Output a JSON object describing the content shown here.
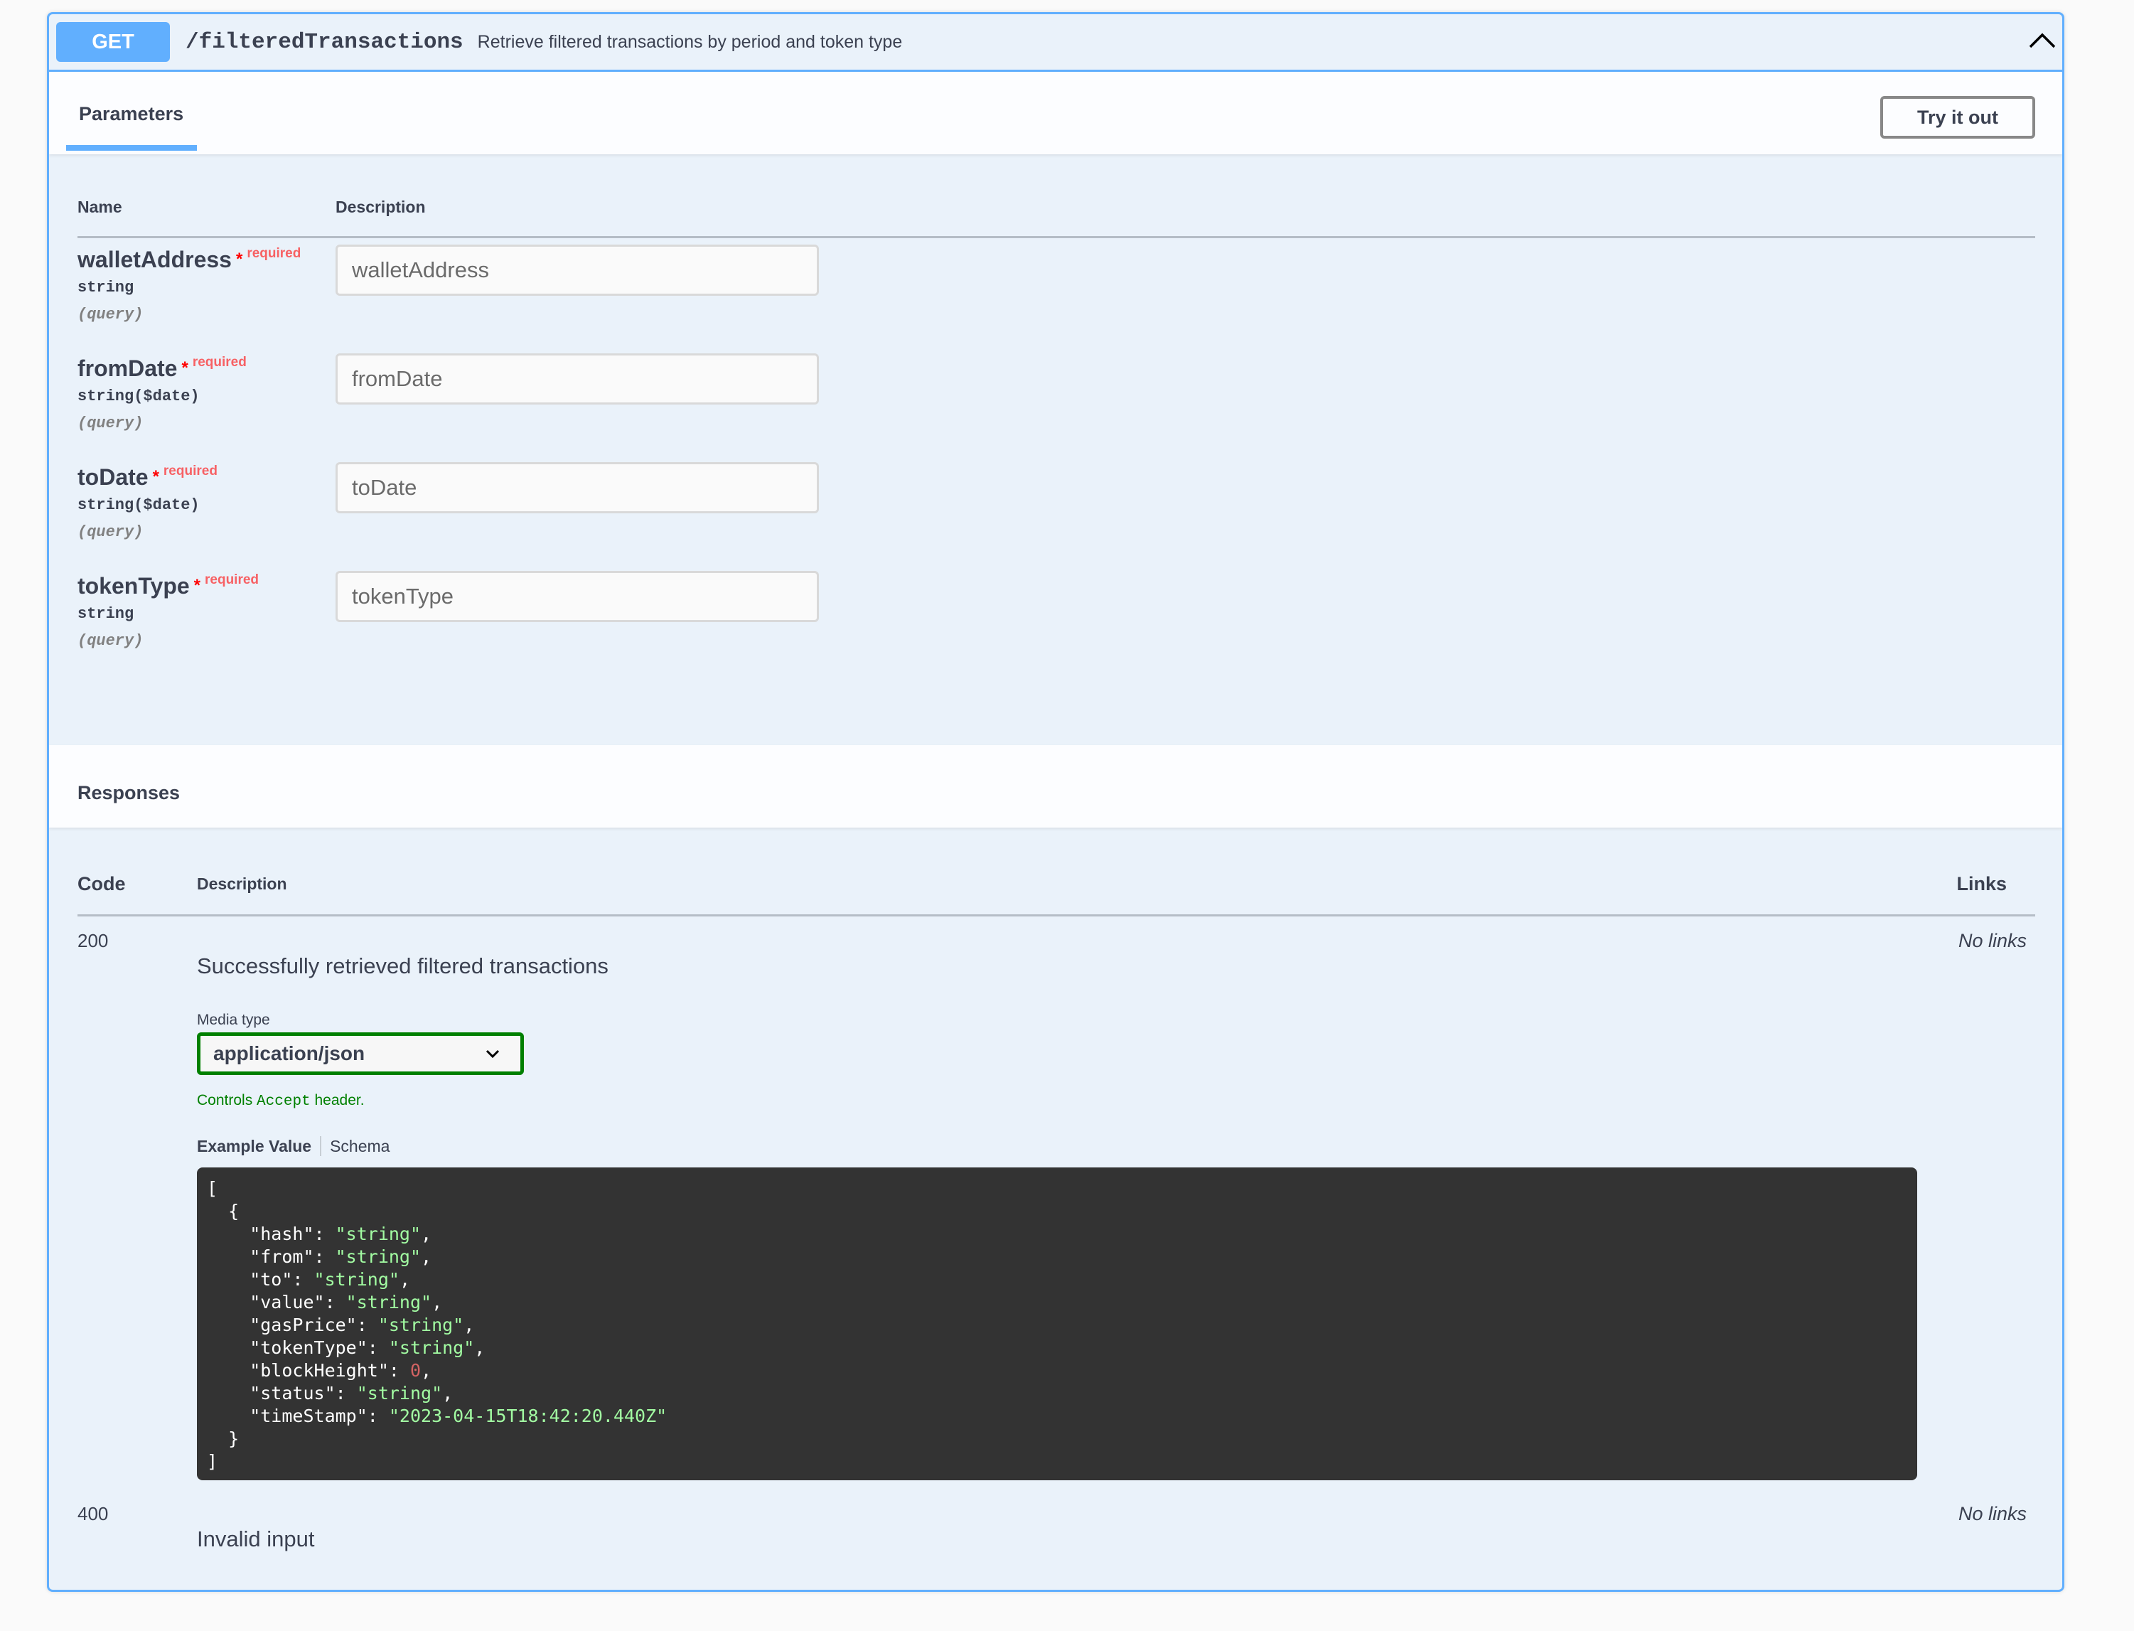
{
  "operation": {
    "method": "GET",
    "path": "/filteredTransactions",
    "summary": "Retrieve filtered transactions by period and token type",
    "expanded_icon": "chevron-up-icon",
    "method_color": "#61affe"
  },
  "parameters_section": {
    "tab_label": "Parameters",
    "try_button_label": "Try it out",
    "columns": {
      "name": "Name",
      "description": "Description"
    },
    "items": [
      {
        "name": "walletAddress",
        "required_mark": "*",
        "required_label": "required",
        "type": "string",
        "in": "(query)",
        "placeholder": "walletAddress",
        "value": ""
      },
      {
        "name": "fromDate",
        "required_mark": "*",
        "required_label": "required",
        "type": "string($date)",
        "in": "(query)",
        "placeholder": "fromDate",
        "value": ""
      },
      {
        "name": "toDate",
        "required_mark": "*",
        "required_label": "required",
        "type": "string($date)",
        "in": "(query)",
        "placeholder": "toDate",
        "value": ""
      },
      {
        "name": "tokenType",
        "required_mark": "*",
        "required_label": "required",
        "type": "string",
        "in": "(query)",
        "placeholder": "tokenType",
        "value": ""
      }
    ]
  },
  "responses_section": {
    "title": "Responses",
    "columns": {
      "code": "Code",
      "description": "Description",
      "links": "Links"
    },
    "items": [
      {
        "code": "200",
        "description": "Successfully retrieved filtered transactions",
        "links": "No links",
        "media_type_label": "Media type",
        "media_type_value": "application/json",
        "controls_note_prefix": "Controls ",
        "controls_note_code": "Accept",
        "controls_note_suffix": " header.",
        "example_tab": "Example Value",
        "schema_tab": "Schema",
        "example": {
          "open_bracket": "[",
          "open_brace": "{",
          "fields": [
            {
              "key": "\"hash\"",
              "value": "\"string\"",
              "kind": "string",
              "trail": ","
            },
            {
              "key": "\"from\"",
              "value": "\"string\"",
              "kind": "string",
              "trail": ","
            },
            {
              "key": "\"to\"",
              "value": "\"string\"",
              "kind": "string",
              "trail": ","
            },
            {
              "key": "\"value\"",
              "value": "\"string\"",
              "kind": "string",
              "trail": ","
            },
            {
              "key": "\"gasPrice\"",
              "value": "\"string\"",
              "kind": "string",
              "trail": ","
            },
            {
              "key": "\"tokenType\"",
              "value": "\"string\"",
              "kind": "string",
              "trail": ","
            },
            {
              "key": "\"blockHeight\"",
              "value": "0",
              "kind": "number",
              "trail": ","
            },
            {
              "key": "\"status\"",
              "value": "\"string\"",
              "kind": "string",
              "trail": ","
            },
            {
              "key": "\"timeStamp\"",
              "value": "\"2023-04-15T18:42:20.440Z\"",
              "kind": "string",
              "trail": ""
            }
          ],
          "close_brace": "}",
          "close_bracket": "]"
        }
      },
      {
        "code": "400",
        "description": "Invalid input",
        "links": "No links"
      }
    ]
  }
}
